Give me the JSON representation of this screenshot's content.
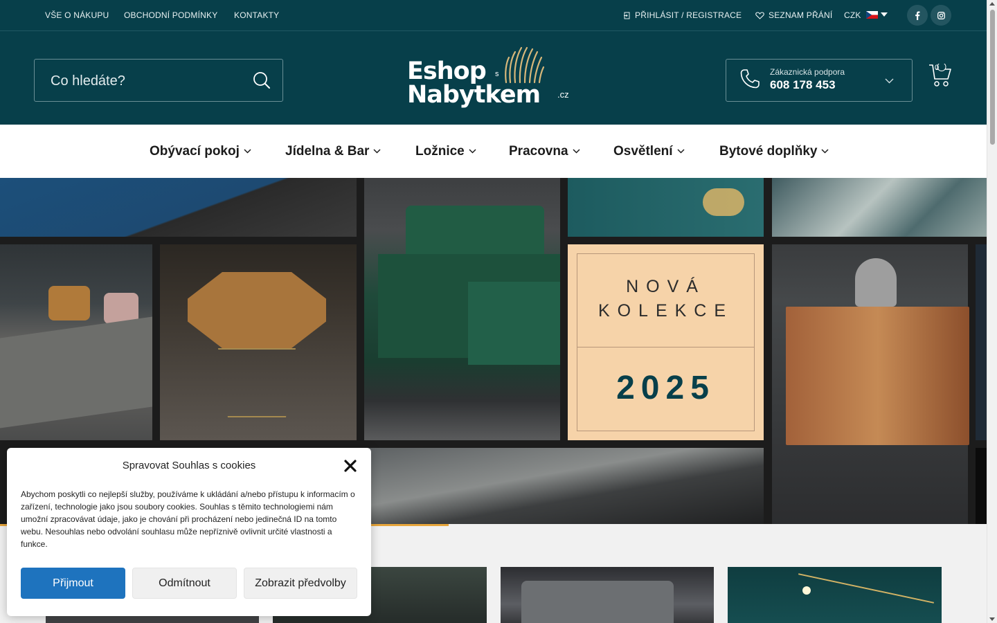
{
  "topbar": {
    "links": [
      "VŠE O NÁKUPU",
      "OBCHODNÍ PODMÍNKY",
      "KONTAKTY"
    ],
    "login": "PŘIHLÁSIT / REGISTRACE",
    "wishlist": "SEZNAM PŘÁNÍ",
    "currency": "CZK",
    "social": [
      "facebook-icon",
      "instagram-icon"
    ]
  },
  "header": {
    "search_placeholder": "Co hledáte?",
    "logo": {
      "line1": "Eshop",
      "small": "s",
      "line2": "Nabytkem",
      "tld": ".cz"
    },
    "support_label": "Zákaznická podpora",
    "support_phone": "608 178 453",
    "cart_count": "0"
  },
  "nav": {
    "items": [
      "Obývací pokoj",
      "Jídelna & Bar",
      "Ložnice",
      "Pracovna",
      "Osvětlení",
      "Bytové doplňky"
    ]
  },
  "hero": {
    "promo_line1": "NOVÁ",
    "promo_line2": "KOLEKCE",
    "promo_year": "2025"
  },
  "cookie": {
    "title": "Spravovat Souhlas s cookies",
    "body": "Abychom poskytli co nejlepší služby, používáme k ukládání a/nebo přístupu k informacím o zařízení, technologie jako jsou soubory cookies. Souhlas s těmito technologiemi nám umožní zpracovávat údaje, jako je chování při procházení nebo jedinečná ID na tomto webu. Nesouhlas nebo odvolání souhlasu může nepříznivě ovlivnit určité vlastnosti a funkce.",
    "accept": "Přijmout",
    "reject": "Odmítnout",
    "preferences": "Zobrazit předvolby"
  },
  "colors": {
    "brand_teal": "#073f4a",
    "accent_orange": "#e7a53b",
    "primary_button": "#1e73be",
    "promo_bg": "#f6d3a9"
  }
}
